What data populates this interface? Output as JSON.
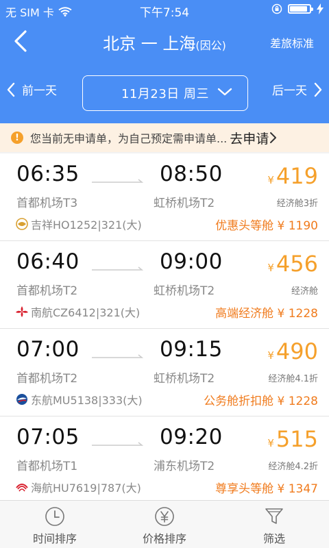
{
  "status": {
    "carrier": "无 SIM 卡",
    "time": "下午7:54"
  },
  "nav": {
    "title": "北京 一 上海",
    "title_suffix": "(因公)",
    "right_action": "差旅标准"
  },
  "date_bar": {
    "prev": "前一天",
    "date": "11月23日 周三",
    "next": "后一天"
  },
  "notice": {
    "text": "您当前无申请单，为自己预定需申请单...",
    "action": "去申请"
  },
  "flights": [
    {
      "dep_time": "06:35",
      "arr_time": "08:50",
      "dep_airport": "首都机场T3",
      "arr_airport": "虹桥机场T2",
      "airline": "吉祥HO1252|321(大)",
      "price_currency": "¥",
      "price": "419",
      "cabin": "经济舱3折",
      "promo": "优惠头等舱 ¥ 1190",
      "logo": "juneyao-logo"
    },
    {
      "dep_time": "06:40",
      "arr_time": "09:00",
      "dep_airport": "首都机场T2",
      "arr_airport": "虹桥机场T2",
      "airline": "南航CZ6412|321(大)",
      "price_currency": "¥",
      "price": "456",
      "cabin": "经济舱",
      "promo": "高端经济舱 ¥ 1228",
      "logo": "china-southern-logo"
    },
    {
      "dep_time": "07:00",
      "arr_time": "09:15",
      "dep_airport": "首都机场T2",
      "arr_airport": "虹桥机场T2",
      "airline": "东航MU5138|333(大)",
      "price_currency": "¥",
      "price": "490",
      "cabin": "经济舱4.1折",
      "promo": "公务舱折扣舱 ¥ 1228",
      "logo": "china-eastern-logo"
    },
    {
      "dep_time": "07:05",
      "arr_time": "09:20",
      "dep_airport": "首都机场T1",
      "arr_airport": "浦东机场T2",
      "airline": "海航HU7619|787(大)",
      "price_currency": "¥",
      "price": "515",
      "cabin": "经济舱4.2折",
      "promo": "尊享头等舱 ¥ 1347",
      "logo": "hainan-airlines-logo"
    }
  ],
  "tabs": [
    {
      "label": "时间排序",
      "icon": "clock-icon"
    },
    {
      "label": "价格排序",
      "icon": "yen-icon"
    },
    {
      "label": "筛选",
      "icon": "filter-icon"
    }
  ],
  "colors": {
    "header": "#4a8ef5",
    "price": "#f5a02b",
    "promo": "#f07b1d",
    "notice_bg": "#fdf1e3"
  }
}
